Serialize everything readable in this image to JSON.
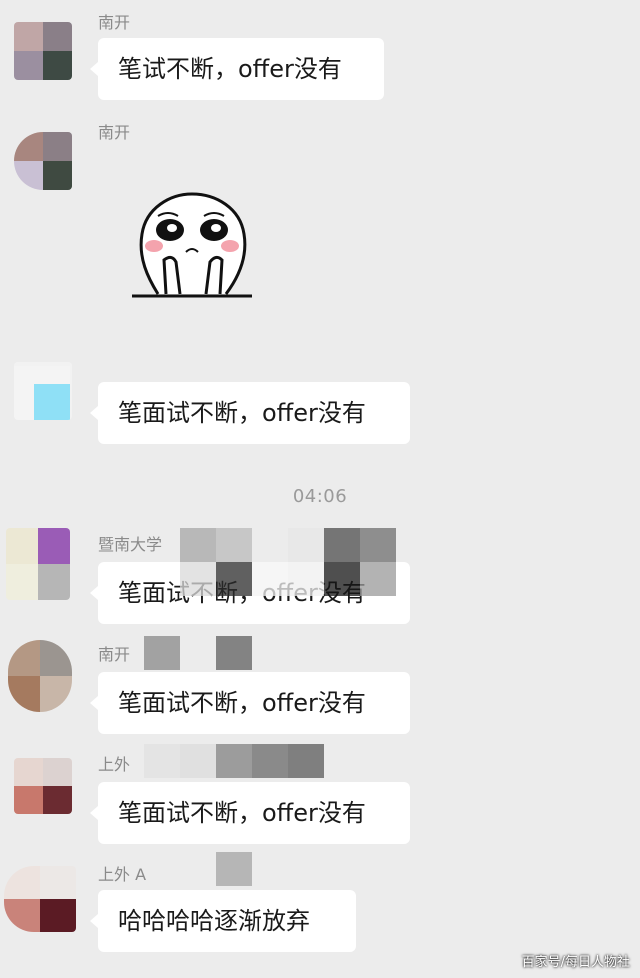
{
  "chat": {
    "messages": [
      {
        "sender": "南开",
        "text": "笔试不断，offer没有"
      },
      {
        "sender": "南开",
        "sticker": "sad-face-sticker"
      },
      {
        "sender": "",
        "text": "笔面试不断，offer没有"
      },
      {
        "sender": "暨南大学",
        "text": "笔面试不断，offer没有"
      },
      {
        "sender": "南开",
        "text": "笔面试不断，offer没有"
      },
      {
        "sender": "上外",
        "text": "笔面试不断，offer没有"
      },
      {
        "sender": "上外 A",
        "text": "哈哈哈哈逐渐放弃"
      }
    ],
    "timestamp": "04:06"
  },
  "watermark": "百家号/每日人物社",
  "colors": {
    "background": "#ececec",
    "bubble": "#ffffff",
    "sender_text": "#8a8a8a"
  }
}
